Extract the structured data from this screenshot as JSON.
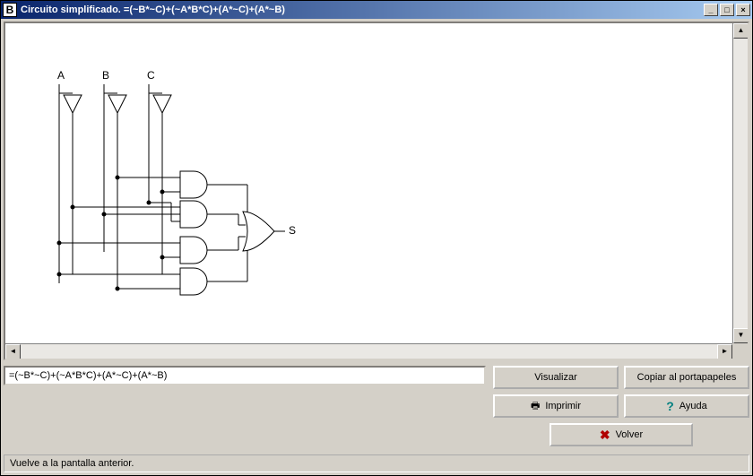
{
  "window": {
    "title": "Circuito simplificado.  =(~B*~C)+(~A*B*C)+(A*~C)+(A*~B)",
    "app_icon_letter": "B"
  },
  "circuit": {
    "inputs": [
      "A",
      "B",
      "C"
    ],
    "output_label": "S"
  },
  "expression_field": {
    "value": "=(~B*~C)+(~A*B*C)+(A*~C)+(A*~B)"
  },
  "buttons": {
    "visualizar": "Visualizar",
    "copiar": "Copiar al portapapeles",
    "imprimir": "Imprimir",
    "ayuda": "Ayuda",
    "volver": "Volver"
  },
  "status_bar": {
    "text": "Vuelve a la pantalla anterior."
  },
  "win_controls": {
    "minimize": "_",
    "maximize": "□",
    "close": "×"
  }
}
